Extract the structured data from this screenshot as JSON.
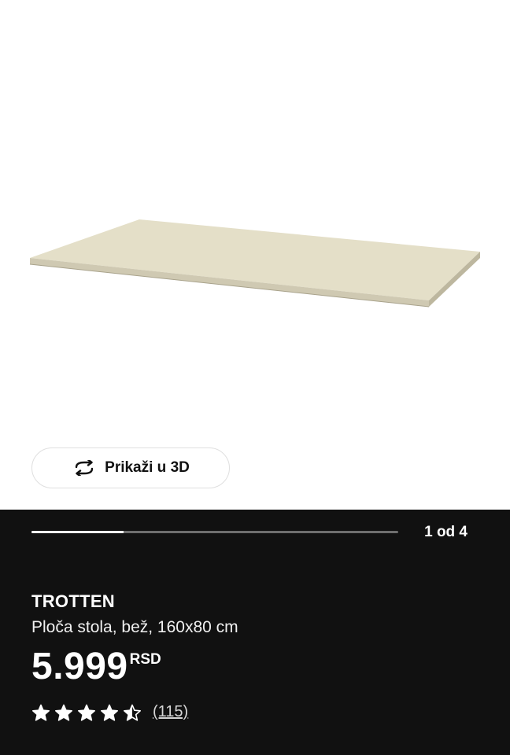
{
  "product_image": {
    "alt": "TROTTEN",
    "color": "#e4dfc8"
  },
  "view_3d": {
    "label": "Prikaži u 3D",
    "icon": "rotate-3d-icon"
  },
  "gallery": {
    "current": 1,
    "total": 4,
    "counter_text": "1 od 4",
    "progress_fraction": 0.25
  },
  "product": {
    "name": "TROTTEN",
    "description": "Ploča stola, bež, 160x80 cm",
    "price": "5.999",
    "currency": "RSD"
  },
  "rating": {
    "value": 4.5,
    "max": 5,
    "review_count_text": "(115)"
  },
  "colors": {
    "panel_bg": "#111111",
    "text": "#ffffff",
    "track": "#6e6e6e"
  }
}
